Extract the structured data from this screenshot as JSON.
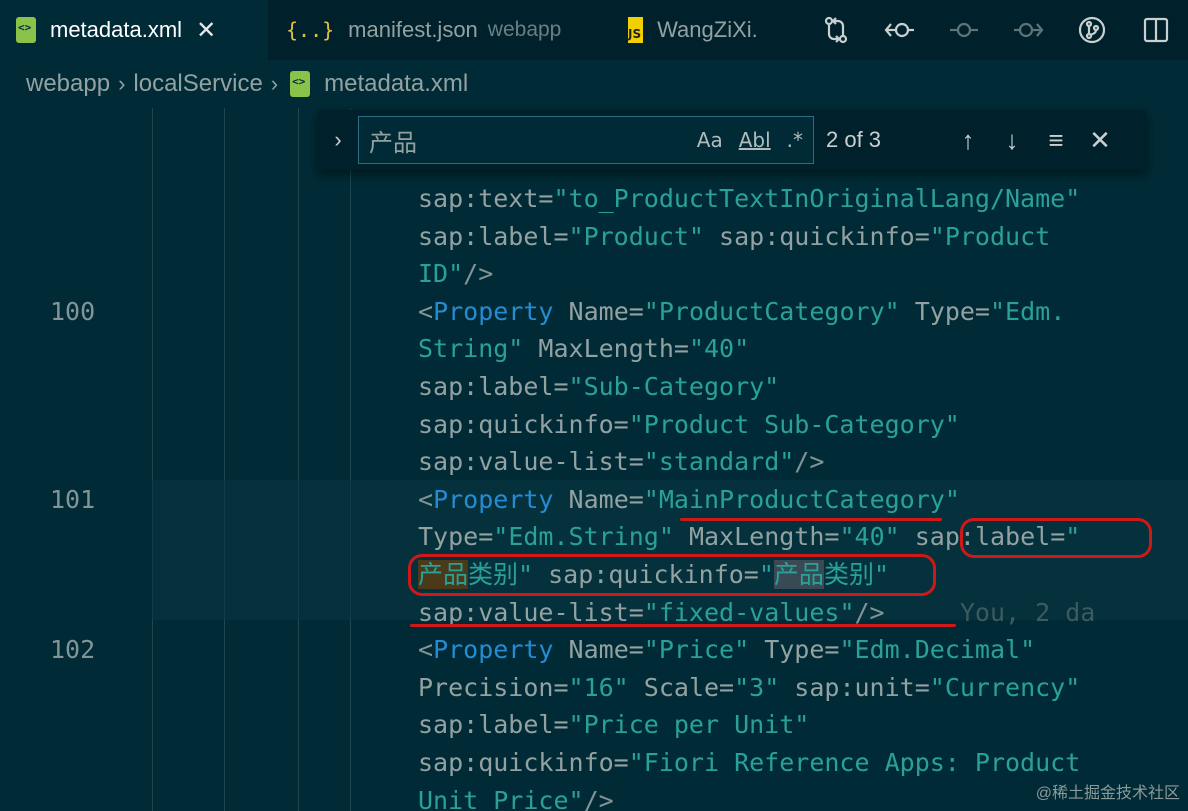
{
  "tabs": [
    {
      "label": "metadata.xml",
      "icon": "xml-file-icon",
      "active": true
    },
    {
      "label": "manifest.json",
      "detail": "webapp",
      "icon": "json-file-icon"
    },
    {
      "label": "WangZiXi.",
      "icon": "js-file-icon"
    }
  ],
  "tab_close": "✕",
  "breadcrumb": [
    "webapp",
    "localService",
    "metadata.xml"
  ],
  "find": {
    "query": "产品",
    "match_case": "Aa",
    "whole_word": "Abl",
    "regex": ".*",
    "count": "2 of 3"
  },
  "lines": [
    {
      "num": "",
      "top": 0,
      "parts": [
        [
          "a",
          "sap:text="
        ],
        [
          "s",
          "\"to_ProductTextInOriginalLang/Name\""
        ]
      ]
    },
    {
      "num": "",
      "top": 0,
      "parts": [
        [
          "a",
          "sap:label="
        ],
        [
          "s",
          "\"Product\""
        ],
        [
          "a",
          " sap:quickinfo="
        ],
        [
          "s",
          "\"Product"
        ]
      ]
    },
    {
      "num": "",
      "top": 0,
      "parts": [
        [
          "s",
          "ID\""
        ],
        [
          "p",
          "/>"
        ]
      ]
    },
    {
      "num": "100",
      "top": 0,
      "parts": [
        [
          "p",
          "<"
        ],
        [
          "t",
          "Property"
        ],
        [
          "a",
          " Name="
        ],
        [
          "s",
          "\"ProductCategory\""
        ],
        [
          "a",
          " Type="
        ],
        [
          "s",
          "\"Edm."
        ]
      ]
    },
    {
      "num": "",
      "top": 0,
      "parts": [
        [
          "s",
          "String\""
        ],
        [
          "a",
          " MaxLength="
        ],
        [
          "s",
          "\"40\""
        ]
      ]
    },
    {
      "num": "",
      "top": 0,
      "parts": [
        [
          "a",
          "sap:label="
        ],
        [
          "s",
          "\"Sub-Category\""
        ]
      ]
    },
    {
      "num": "",
      "top": 0,
      "parts": [
        [
          "a",
          "sap:quickinfo="
        ],
        [
          "s",
          "\"Product Sub-Category\""
        ]
      ]
    },
    {
      "num": "",
      "top": 0,
      "parts": [
        [
          "a",
          "sap:value-list="
        ],
        [
          "s",
          "\"standard\""
        ],
        [
          "p",
          "/>"
        ]
      ]
    },
    {
      "num": "101",
      "top": 0,
      "parts": [
        [
          "p",
          "<"
        ],
        [
          "t",
          "Property"
        ],
        [
          "a",
          " Name="
        ],
        [
          "s",
          "\"MainProductCategory\""
        ]
      ]
    },
    {
      "num": "",
      "top": 0,
      "parts": [
        [
          "a",
          "Type="
        ],
        [
          "s",
          "\"Edm.String\""
        ],
        [
          "a",
          " MaxLength="
        ],
        [
          "s",
          "\"40\""
        ],
        [
          "a",
          " sap:label="
        ],
        [
          "s",
          "\""
        ]
      ]
    },
    {
      "num": "",
      "top": 0,
      "parts": [
        [
          "hl",
          "产品"
        ],
        [
          "s",
          "类别\""
        ],
        [
          "a",
          " sap:quickinfo="
        ],
        [
          "s",
          "\""
        ],
        [
          "hl2",
          "产品"
        ],
        [
          "s",
          "类别\""
        ]
      ]
    },
    {
      "num": "",
      "top": 0,
      "parts": [
        [
          "a",
          "sap:value-list="
        ],
        [
          "s",
          "\"fixed-values\""
        ],
        [
          "p",
          "/>"
        ],
        [
          "blame",
          "     You, 2 da"
        ]
      ]
    },
    {
      "num": "102",
      "top": 0,
      "parts": [
        [
          "p",
          "<"
        ],
        [
          "t",
          "Property"
        ],
        [
          "a",
          " Name="
        ],
        [
          "s",
          "\"Price\""
        ],
        [
          "a",
          " Type="
        ],
        [
          "s",
          "\"Edm.Decimal\""
        ]
      ]
    },
    {
      "num": "",
      "top": 0,
      "parts": [
        [
          "a",
          "Precision="
        ],
        [
          "s",
          "\"16\""
        ],
        [
          "a",
          " Scale="
        ],
        [
          "s",
          "\"3\""
        ],
        [
          "a",
          " sap:unit="
        ],
        [
          "s",
          "\"Currency\""
        ]
      ]
    },
    {
      "num": "",
      "top": 0,
      "parts": [
        [
          "a",
          "sap:label="
        ],
        [
          "s",
          "\"Price per Unit\""
        ]
      ]
    },
    {
      "num": "",
      "top": 0,
      "parts": [
        [
          "a",
          "sap:quickinfo="
        ],
        [
          "s",
          "\"Fiori Reference Apps: Product"
        ]
      ]
    },
    {
      "num": "",
      "top": 0,
      "parts": [
        [
          "s",
          "Unit Price\""
        ],
        [
          "p",
          "/>"
        ]
      ]
    }
  ],
  "watermark": "@稀土掘金技术社区"
}
